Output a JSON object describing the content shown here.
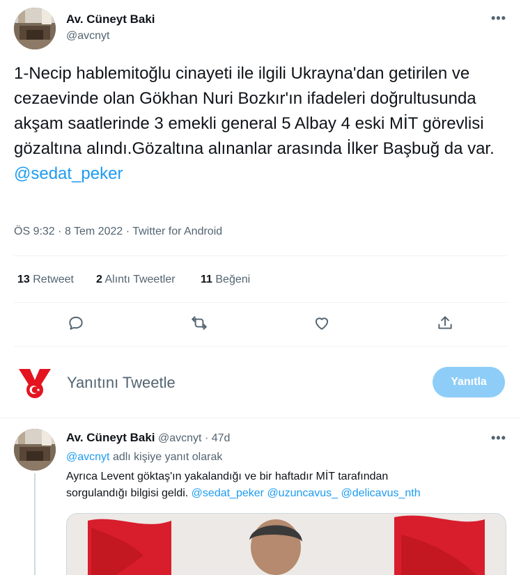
{
  "main_tweet": {
    "author_name": "Av. Cüneyt Baki",
    "author_handle": "@avcnyt",
    "text": "1-Necip hablemitoğlu cinayeti ile ilgili Ukrayna'dan getirilen ve cezaevinde olan Gökhan Nuri Bozkır'ın ifadeleri doğrultusunda akşam saatlerinde 3 emekli general 5 Albay 4 eski MİT görevlisi gözaltına alındı.Gözaltına alınanlar arasında İlker Başbuğ da var.",
    "mention": "@sedat_peker",
    "time": "ÖS 9:32",
    "date": "8 Tem 2022",
    "source": "Twitter for Android",
    "stats": {
      "retweet_count": "13",
      "retweet_label": "Retweet",
      "quote_count": "2",
      "quote_label": "Alıntı Tweetler",
      "like_count": "11",
      "like_label": "Beğeni"
    }
  },
  "reply_box": {
    "placeholder": "Yanıtını Tweetle",
    "button_label": "Yanıtla"
  },
  "reply_tweet": {
    "author_name": "Av. Cüneyt Baki",
    "author_handle": "@avcnyt",
    "time_ago": "47d",
    "reply_to_handle": "@avcnyt",
    "reply_to_suffix": "adlı kişiye yanıt olarak",
    "text_line1": "Ayrıca Levent göktaş'ın yakalandığı ve bir haftadır MİT tarafından",
    "text_line2": "sorgulandığı bilgisi geldi.",
    "mention1": "@sedat_peker",
    "mention2": "@uzuncavus_",
    "mention3": "@delicavus_nth"
  },
  "colors": {
    "accent": "#1d9bf0",
    "text": "#0f1419",
    "secondary": "#536471",
    "divider": "#eff3f4",
    "reply_button_disabled": "#8ecdf8"
  },
  "icons": [
    "more-icon",
    "reply-icon",
    "retweet-icon",
    "like-icon",
    "share-icon",
    "medal-logo-icon"
  ]
}
